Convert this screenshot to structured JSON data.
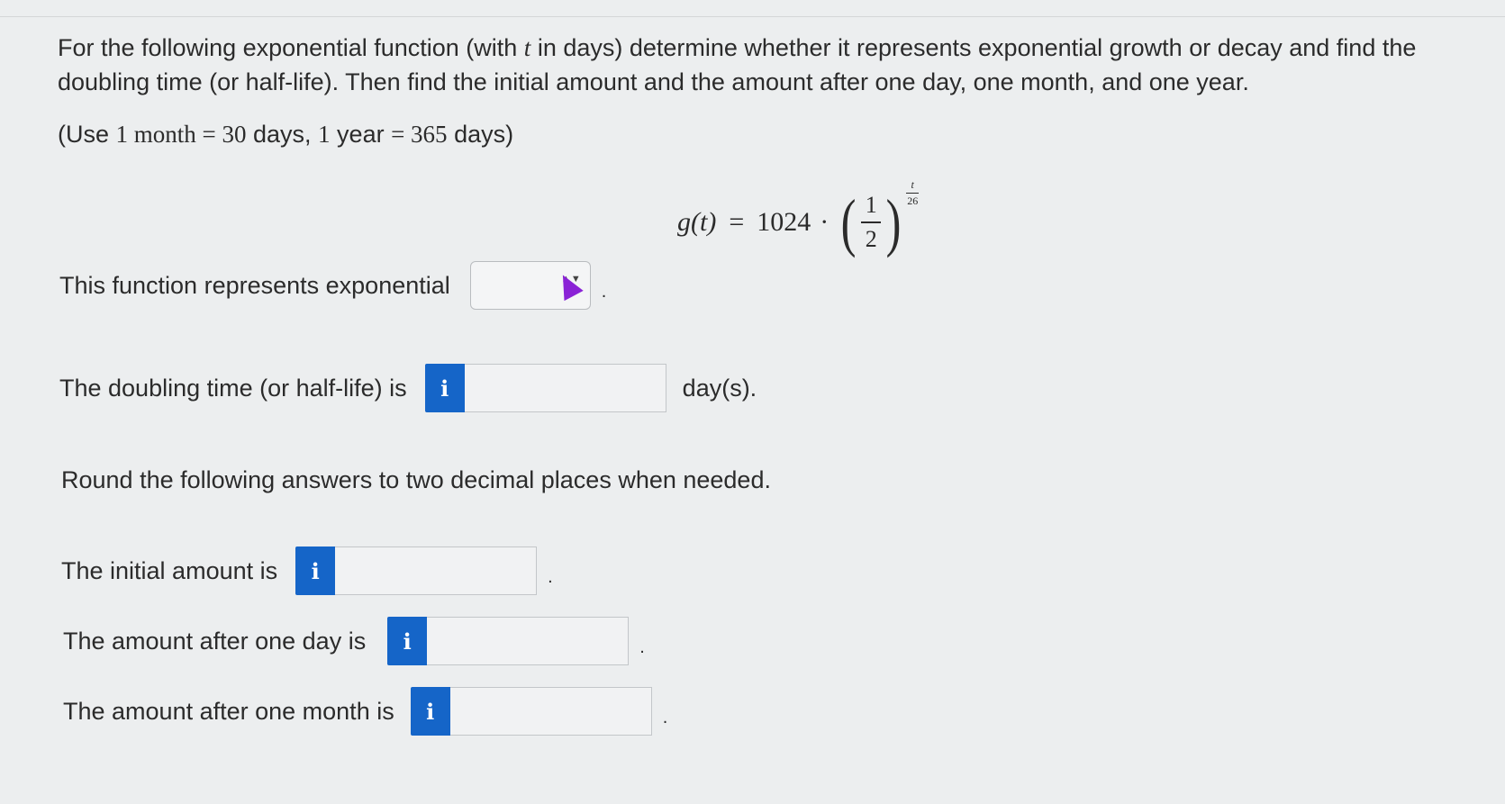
{
  "question": {
    "intro": "For the following exponential function (with t in days) determine whether it represents exponential growth or decay and find the doubling time (or half-life). Then find the initial amount and the amount after one day, one month, and one year.",
    "intro_part1": "For the following exponential function (with ",
    "intro_var": "t",
    "intro_part2": " in days) determine whether it represents exponential growth or decay and find the doubling time (or half-life). Then find the initial amount and the amount after one day, one month, and one year.",
    "use_note": "(Use 1 month = 30 days, 1 year = 365 days)",
    "use_open": "(Use ",
    "use_month": "1 month  =  30",
    "use_days": " days, ",
    "use_year": "1",
    "use_year_word": " year  ",
    "use_eq": "=  365",
    "use_close": " days)"
  },
  "formula": {
    "lhs": "g(t)",
    "eq": "=",
    "coef": "1024",
    "dot": "·",
    "base_num": "1",
    "base_den": "2",
    "exp_num": "t",
    "exp_den": "26"
  },
  "rows": {
    "type_label": "This function represents exponential",
    "type_value": "",
    "halflife_label": "The doubling time (or half-life) is",
    "halflife_value": "",
    "halflife_unit": "day(s).",
    "round_note": "Round the following answers to two decimal places when needed.",
    "initial_label": "The initial amount is",
    "initial_value": "",
    "day_label": "The amount after one day is",
    "day_value": "",
    "month_label": "The amount after one month is",
    "month_value": ""
  },
  "icons": {
    "info": "i",
    "info_icon_name": "info-icon",
    "select_arrows": "▲▼"
  },
  "colors": {
    "info_button": "#1565c8",
    "cursor": "#8a22d6",
    "background": "#eceeef"
  }
}
